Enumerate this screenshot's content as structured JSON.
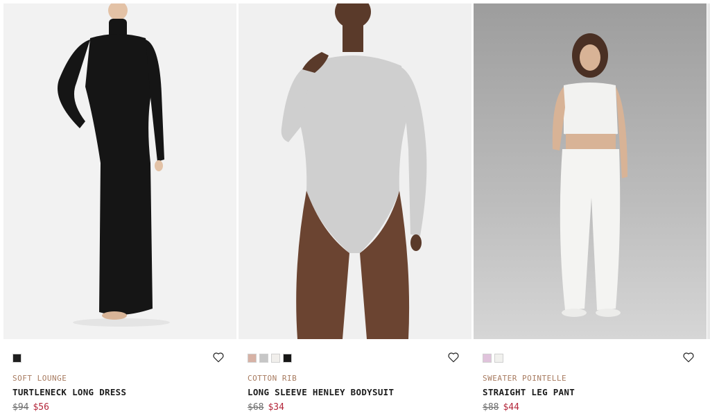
{
  "products": [
    {
      "category": "SOFT LOUNGE",
      "title": "TURTLENECK LONG DRESS",
      "price_original": "$94",
      "price_sale": "$56",
      "swatches": [
        "#1e1e1e"
      ],
      "favorite_icon": "heart-outline-icon"
    },
    {
      "category": "COTTON RIB",
      "title": "LONG SLEEVE HENLEY BODYSUIT",
      "price_original": "$68",
      "price_sale": "$34",
      "swatches": [
        "#d7b2a5",
        "#c6c6c6",
        "#f1efec",
        "#161616"
      ],
      "favorite_icon": "heart-outline-icon"
    },
    {
      "category": "SWEATER POINTELLE",
      "title": "STRAIGHT LEG PANT",
      "price_original": "$88",
      "price_sale": "$44",
      "swatches": [
        "#e0c3dc",
        "#f1f1ee"
      ],
      "favorite_icon": "heart-outline-icon"
    }
  ],
  "colors": {
    "category_text": "#a77a5f",
    "sale_price": "#b3263a",
    "original_price": "#6f6f6f",
    "title_text": "#1b1b1b"
  }
}
